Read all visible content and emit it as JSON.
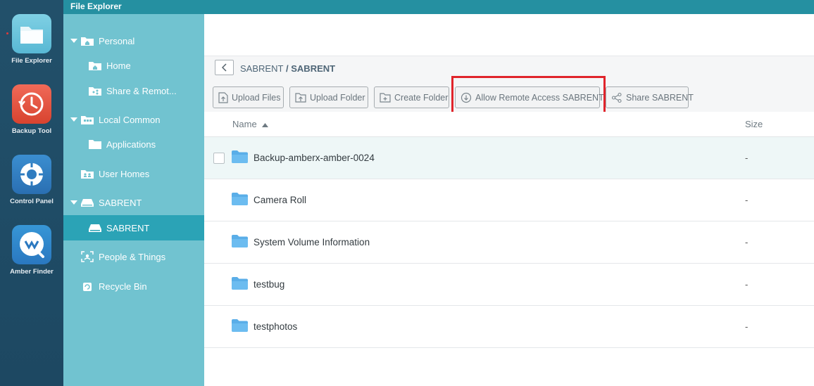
{
  "dock": {
    "apps": [
      {
        "label": "File Explorer",
        "icon": "folder-icon"
      },
      {
        "label": "Backup Tool",
        "icon": "backup-clock-icon"
      },
      {
        "label": "Control Panel",
        "icon": "gear-icon"
      },
      {
        "label": "Amber Finder",
        "icon": "amber-finder-icon"
      }
    ]
  },
  "window": {
    "title": "File Explorer"
  },
  "sidebar": {
    "items": [
      {
        "label": "Personal",
        "icon": "home-folder-icon"
      },
      {
        "label": "Home",
        "icon": "home-folder-icon"
      },
      {
        "label": "Share & Remot...",
        "icon": "share-folder-icon"
      },
      {
        "label": "Local Common",
        "icon": "common-folder-icon"
      },
      {
        "label": "Applications",
        "icon": "folder-icon"
      },
      {
        "label": "User Homes",
        "icon": "users-folder-icon"
      },
      {
        "label": "SABRENT",
        "icon": "drive-icon"
      },
      {
        "label": "SABRENT",
        "icon": "drive-icon"
      },
      {
        "label": "People & Things",
        "icon": "face-scan-icon"
      },
      {
        "label": "Recycle Bin",
        "icon": "recycle-bin-icon"
      }
    ]
  },
  "breadcrumb": {
    "parent": "SABRENT",
    "separator": " / ",
    "current": "SABRENT"
  },
  "toolbar": {
    "upload_files": "Upload Files",
    "upload_folder": "Upload Folder",
    "create_folder": "Create Folder",
    "allow_remote": "Allow Remote Access SABRENT",
    "share": "Share SABRENT"
  },
  "table": {
    "columns": {
      "name": "Name",
      "size": "Size"
    },
    "rows": [
      {
        "name": "Backup-amberx-amber-0024",
        "size": "-"
      },
      {
        "name": "Camera Roll",
        "size": "-"
      },
      {
        "name": "System Volume Information",
        "size": "-"
      },
      {
        "name": "testbug",
        "size": "-"
      },
      {
        "name": "testphotos",
        "size": "-"
      }
    ]
  },
  "colors": {
    "titlebar": "#2590a1",
    "sidebar": "#71c3d0",
    "sidebar_active": "#2ba3b6",
    "highlight": "#e0242b",
    "folder": "#5aaee8"
  }
}
